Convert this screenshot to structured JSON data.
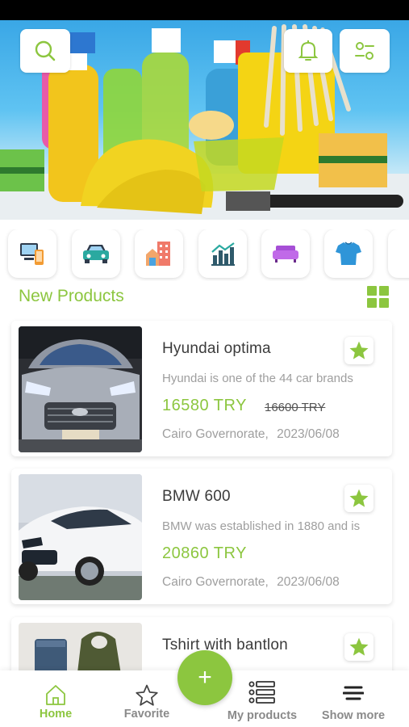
{
  "theme": {
    "accent": "#8cc63f",
    "text": "#3b3b3b",
    "muted": "#9e9e9e"
  },
  "header": {
    "search_icon": "search-icon",
    "notification_icon": "bell-icon",
    "filter_icon": "filter-icon"
  },
  "categories": [
    {
      "name": "electronics",
      "icon": "devices-icon"
    },
    {
      "name": "cars",
      "icon": "car-icon"
    },
    {
      "name": "real-estate",
      "icon": "buildings-icon"
    },
    {
      "name": "business",
      "icon": "chart-icon"
    },
    {
      "name": "furniture",
      "icon": "sofa-icon"
    },
    {
      "name": "fashion",
      "icon": "tshirt-icon"
    }
  ],
  "section": {
    "title": "New Products",
    "view_icon": "grid-view-icon"
  },
  "products": [
    {
      "title": "Hyundai optima",
      "description": "Hyundai is one of the 44 car brands",
      "price": "16580 TRY",
      "old_price": "16600 TRY",
      "location": "Cairo Governorate,",
      "date": "2023/06/08"
    },
    {
      "title": "BMW 600",
      "description": "BMW was established in 1880 and is",
      "price": "20860 TRY",
      "old_price": "",
      "location": "Cairo Governorate,",
      "date": "2023/06/08"
    },
    {
      "title": "Tshirt with bantlon",
      "description": "",
      "price": "",
      "old_price": "",
      "location": "",
      "date": ""
    }
  ],
  "bottom_nav": {
    "home": "Home",
    "favorite": "Favorite",
    "add": "+",
    "my_products": "My products",
    "show_more": "Show more"
  }
}
